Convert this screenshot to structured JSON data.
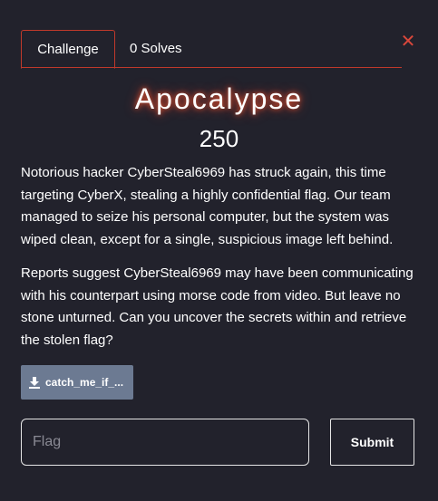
{
  "tabs": [
    {
      "label": "Challenge"
    },
    {
      "label": "0 Solves"
    }
  ],
  "close_icon": "close-icon",
  "challenge": {
    "title": "Apocalypse",
    "points": "250",
    "description": [
      "Notorious hacker CyberSteal6969 has struck again, this time targeting CyberX, stealing a highly confidential flag. Our team managed to seize his personal computer, but the system was wiped clean, except for a single, suspicious image left behind.",
      "Reports suggest CyberSteal6969 may have been communicating with his counterpart using morse code from video. But leave no stone unturned. Can you uncover the secrets within and retrieve the stolen flag?"
    ]
  },
  "file": {
    "label": "catch_me_if_...",
    "icon": "download-icon"
  },
  "form": {
    "flag_placeholder": "Flag",
    "flag_value": "",
    "submit_label": "Submit"
  },
  "colors": {
    "background": "#22222c",
    "accent": "#c0392b",
    "close": "#d9473b",
    "file_button": "#6c7a92"
  }
}
